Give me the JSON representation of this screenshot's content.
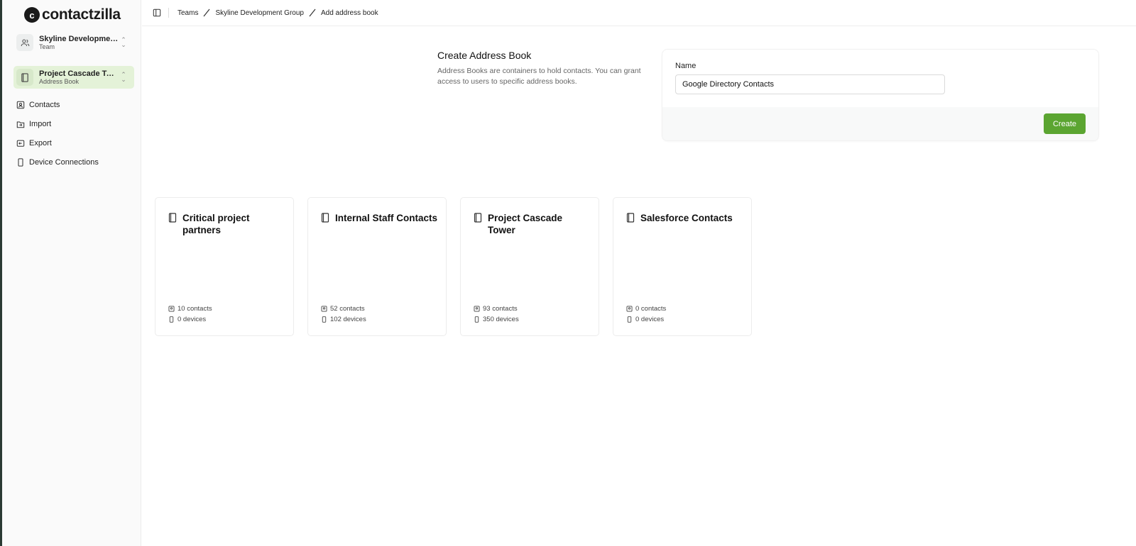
{
  "app": {
    "logo_mark": "c",
    "logo_text": "contactzilla"
  },
  "team_switcher": {
    "title": "Skyline Developmen...",
    "subtitle": "Team",
    "icon": "users-icon"
  },
  "book_switcher": {
    "title": "Project Cascade Tow...",
    "subtitle": "Address Book",
    "icon": "book-icon"
  },
  "nav": [
    {
      "label": "Contacts",
      "icon": "contact-card-icon"
    },
    {
      "label": "Import",
      "icon": "import-icon"
    },
    {
      "label": "Export",
      "icon": "export-icon"
    },
    {
      "label": "Device Connections",
      "icon": "device-icon"
    }
  ],
  "breadcrumb": [
    "Teams",
    "Skyline Development Group",
    "Add address book"
  ],
  "form": {
    "title": "Create Address Book",
    "description": "Address Books are containers to hold contacts. You can grant access to users to specific address books.",
    "name_label": "Name",
    "name_value": "Google Directory Contacts",
    "create_label": "Create"
  },
  "cards": [
    {
      "title": "Critical project partners",
      "contacts": "10 contacts",
      "devices": "0 devices"
    },
    {
      "title": "Internal Staff Contacts",
      "contacts": "52 contacts",
      "devices": "102 devices"
    },
    {
      "title": "Project Cascade Tower",
      "contacts": "93 contacts",
      "devices": "350 devices"
    },
    {
      "title": "Salesforce Contacts",
      "contacts": "0 contacts",
      "devices": "0 devices"
    }
  ],
  "colors": {
    "accent": "#5ba531",
    "active_bg": "#e4f2d8"
  }
}
